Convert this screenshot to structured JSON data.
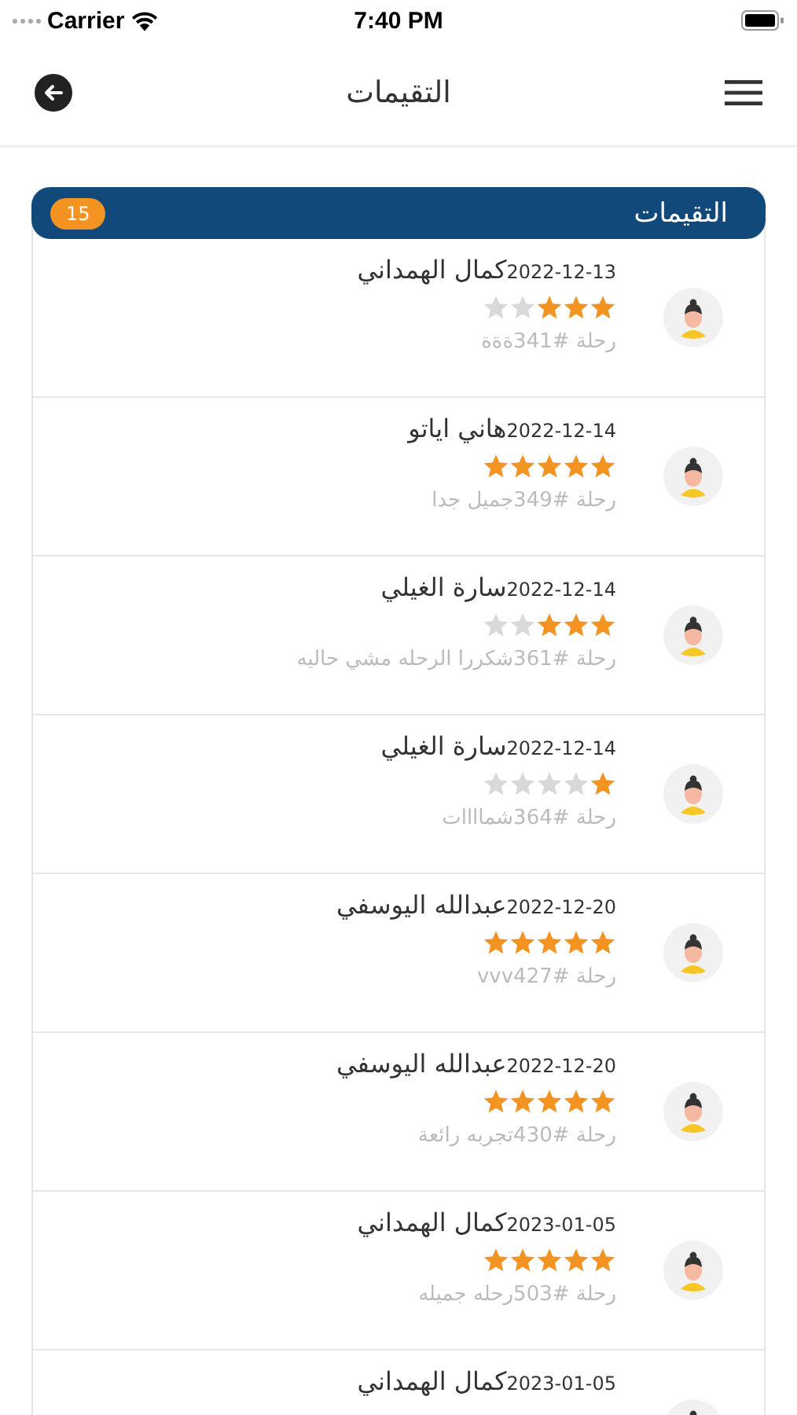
{
  "status_bar": {
    "carrier": "Carrier",
    "time": "7:40 PM"
  },
  "header": {
    "title": "التقيمات"
  },
  "reviews_panel": {
    "title": "التقيمات",
    "count": "15"
  },
  "reviews": [
    {
      "date": "2022-12-13",
      "name": "كمال الهمداني",
      "stars": 3,
      "comment": "رحلة #341ةةة"
    },
    {
      "date": "2022-12-14",
      "name": "هاني اياتو",
      "stars": 5,
      "comment": "رحلة #349جميل جدا"
    },
    {
      "date": "2022-12-14",
      "name": "سارة الغيلي",
      "stars": 3,
      "comment": "رحلة #361شكررا الرحله مشي حاليه"
    },
    {
      "date": "2022-12-14",
      "name": "سارة الغيلي",
      "stars": 1,
      "comment": "رحلة #364شماااات"
    },
    {
      "date": "2022-12-20",
      "name": "عبدالله اليوسفي",
      "stars": 5,
      "comment": "رحلة #vvv427"
    },
    {
      "date": "2022-12-20",
      "name": "عبدالله اليوسفي",
      "stars": 5,
      "comment": "رحلة #430تجربه رائعة"
    },
    {
      "date": "2023-01-05",
      "name": "كمال الهمداني",
      "stars": 5,
      "comment": "رحلة #503رحله جميله"
    },
    {
      "date": "2023-01-05",
      "name": "كمال الهمداني"
    }
  ]
}
